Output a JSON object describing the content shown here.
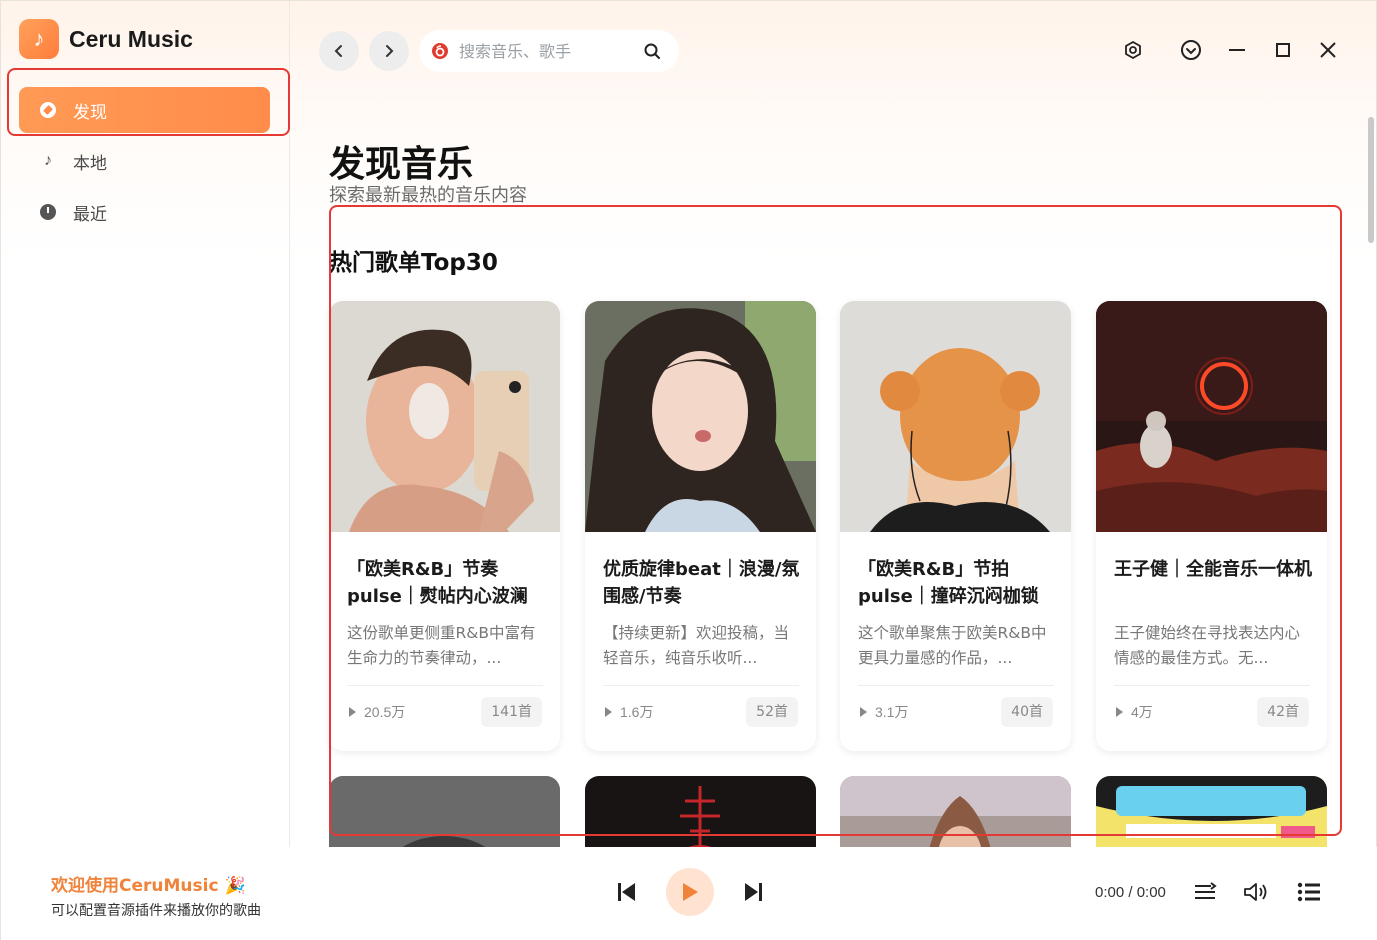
{
  "app": {
    "name": "Ceru Music",
    "logo_icon": "music-note-icon",
    "accent_color": "#ff8c4a"
  },
  "sidebar": {
    "items": [
      {
        "label": "发现",
        "icon": "compass-icon",
        "active": true
      },
      {
        "label": "本地",
        "icon": "music-note-icon",
        "active": false
      },
      {
        "label": "最近",
        "icon": "clock-icon",
        "active": false
      }
    ]
  },
  "topbar": {
    "search_placeholder": "搜索音乐、歌手",
    "search_source_icon": "netease-icon",
    "window_controls": [
      "settings-icon",
      "dropdown-icon",
      "minimize-icon",
      "maximize-icon",
      "close-icon"
    ]
  },
  "main": {
    "title": "发现音乐",
    "subtitle": "探索最新最热的音乐内容",
    "section_title": "热门歌单Top30",
    "playlists": [
      {
        "title": "「欧美R&B」节奏pulse｜熨帖内心波澜",
        "desc": "这份歌单更侧重R&B中富有生命力的节奏律动，...",
        "plays": "20.5万",
        "count": "141首"
      },
      {
        "title": "优质旋律beat｜浪漫/氛围感/节奏",
        "desc": "【持续更新】欢迎投稿，当轻音乐，纯音乐收听...",
        "plays": "1.6万",
        "count": "52首"
      },
      {
        "title": "「欧美R&B」节拍pulse｜撞碎沉闷枷锁",
        "desc": "这个歌单聚焦于欧美R&B中更具力量感的作品，...",
        "plays": "3.1万",
        "count": "40首"
      },
      {
        "title": "王子健｜全能音乐一体机",
        "desc": "王子健始终在寻找表达内心情感的最佳方式。无...",
        "plays": "4万",
        "count": "42首"
      }
    ]
  },
  "player": {
    "welcome": "欢迎使用CeruMusic 🎉",
    "tip": "可以配置音源插件来播放你的歌曲",
    "time": "0:00 / 0:00"
  }
}
